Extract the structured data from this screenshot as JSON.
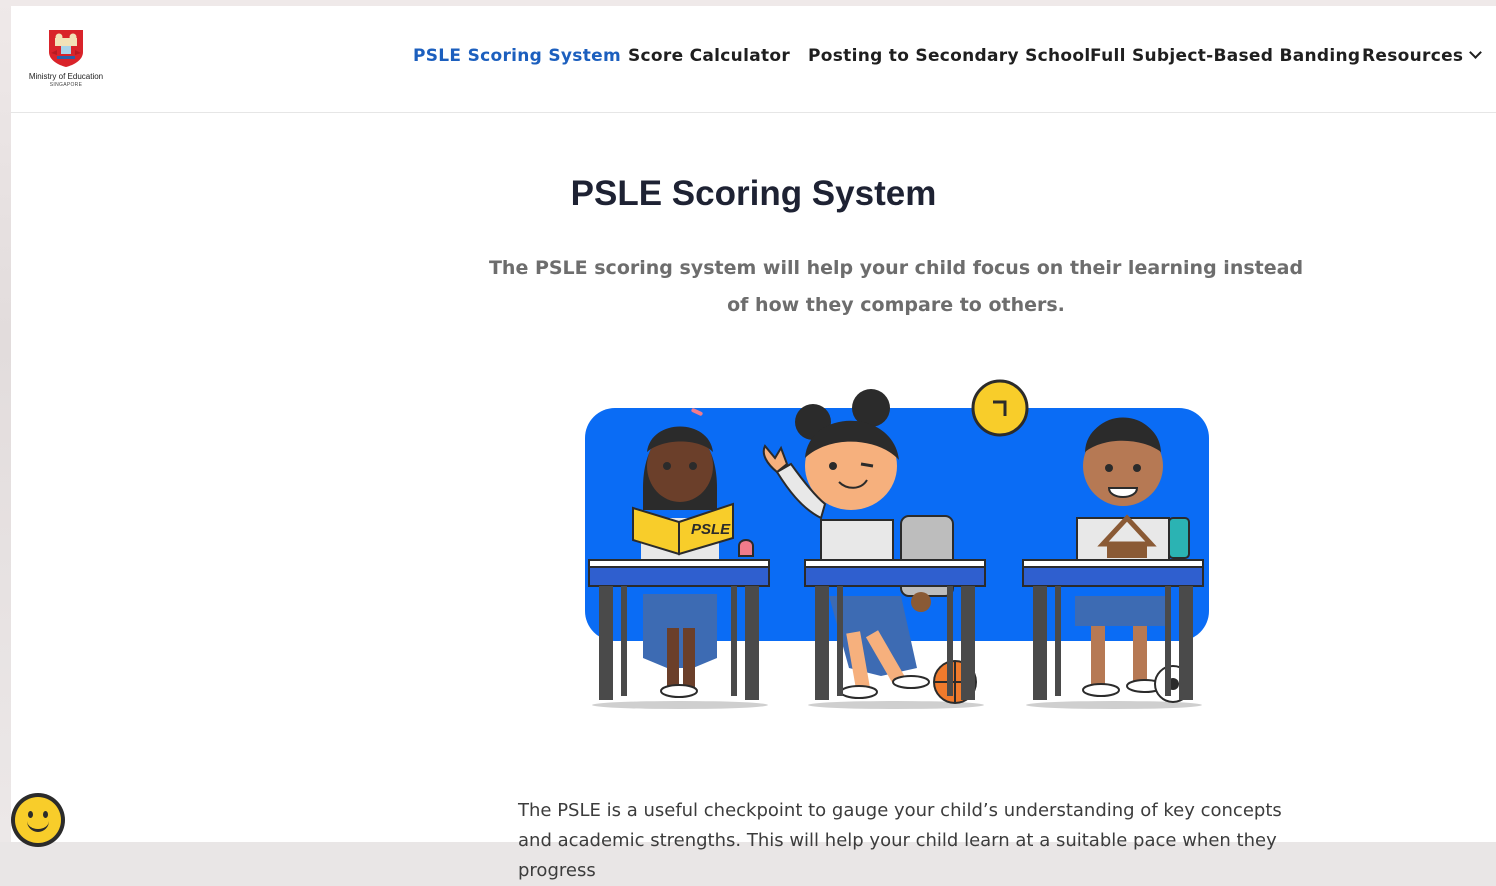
{
  "brand": {
    "name": "Ministry of Education",
    "country": "SINGAPORE"
  },
  "nav": {
    "items": [
      {
        "label": "PSLE Scoring System",
        "active": true
      },
      {
        "label": "Score Calculator",
        "active": false
      },
      {
        "label": "Posting to Secondary School",
        "active": false
      },
      {
        "label": "Full Subject-Based Banding",
        "active": false
      },
      {
        "label": "Resources",
        "active": false
      }
    ]
  },
  "hero": {
    "title": "PSLE Scoring System",
    "subtitle": "The PSLE scoring system will help your child focus on their learning instead of how they compare to others.",
    "book_label": "PSLE"
  },
  "body": {
    "paragraph": "The PSLE is a useful checkpoint to gauge your child’s understanding of key concepts and academic strengths. This will help your child learn at a suitable pace when they progress"
  },
  "colors": {
    "accent": "#1c5fbe",
    "illustration_blue": "#0a6cf5",
    "chat_yellow": "#f8cd2a"
  },
  "icons": {
    "chat": "smiley-face-icon",
    "resources_toggle": "chevron-down-icon"
  }
}
